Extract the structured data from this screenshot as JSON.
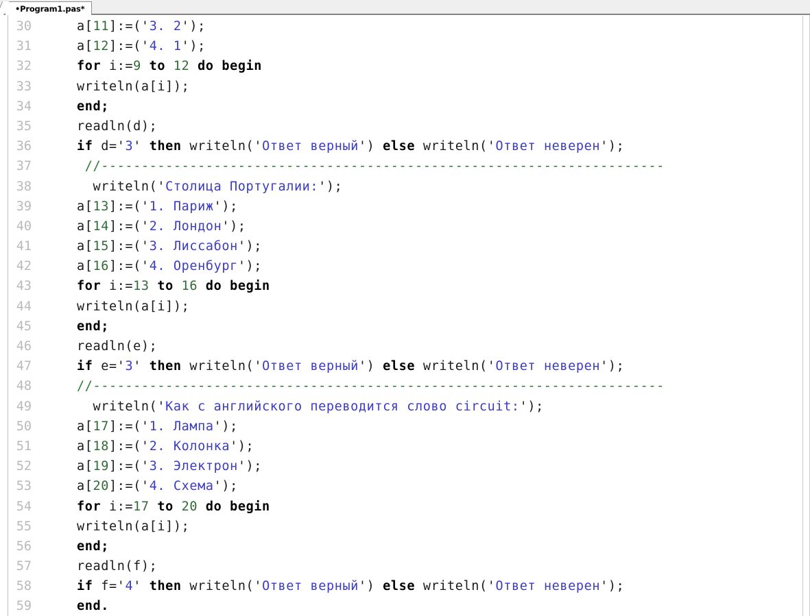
{
  "window": {
    "title": "Program1.pas",
    "background": "#ffffff"
  },
  "tabbar": {
    "tabs": [
      {
        "label": "•Program1.pas*",
        "active": true,
        "modified": true
      }
    ]
  },
  "colors": {
    "keyword": "#000000",
    "number": "#2f6b35",
    "string": "#3b3bc4",
    "comment": "#2b7a35",
    "identifier": "#1a1a1a",
    "line_number": "#b9b9b9",
    "editor_background": "#ffffff",
    "tabbar_background": "#efefef"
  },
  "editor": {
    "language": "pascal",
    "first_visible_line": 30,
    "last_visible_line": 59,
    "lines": [
      {
        "n": "30",
        "tokens": [
          {
            "t": "a",
            "c": "tok-id"
          },
          {
            "t": "[",
            "c": "tok-punc"
          },
          {
            "t": "11",
            "c": "tok-num"
          },
          {
            "t": "]:=('",
            "c": "tok-punc"
          },
          {
            "t": "3. 2",
            "c": "tok-str"
          },
          {
            "t": "');",
            "c": "tok-punc"
          }
        ]
      },
      {
        "n": "31",
        "tokens": [
          {
            "t": "a",
            "c": "tok-id"
          },
          {
            "t": "[",
            "c": "tok-punc"
          },
          {
            "t": "12",
            "c": "tok-num"
          },
          {
            "t": "]:=('",
            "c": "tok-punc"
          },
          {
            "t": "4. 1",
            "c": "tok-str"
          },
          {
            "t": "');",
            "c": "tok-punc"
          }
        ]
      },
      {
        "n": "32",
        "tokens": [
          {
            "t": "for",
            "c": "tok-kw"
          },
          {
            "t": " i:=",
            "c": "tok-id"
          },
          {
            "t": "9",
            "c": "tok-num"
          },
          {
            "t": " ",
            "c": "tok-id"
          },
          {
            "t": "to",
            "c": "tok-kw"
          },
          {
            "t": " ",
            "c": "tok-id"
          },
          {
            "t": "12",
            "c": "tok-num"
          },
          {
            "t": " ",
            "c": "tok-id"
          },
          {
            "t": "do begin",
            "c": "tok-kw"
          }
        ]
      },
      {
        "n": "33",
        "tokens": [
          {
            "t": "writeln(a[i]);",
            "c": "tok-id"
          }
        ]
      },
      {
        "n": "34",
        "tokens": [
          {
            "t": "end;",
            "c": "tok-kw"
          }
        ]
      },
      {
        "n": "35",
        "tokens": [
          {
            "t": "readln(d);",
            "c": "tok-id"
          }
        ]
      },
      {
        "n": "36",
        "tokens": [
          {
            "t": "if",
            "c": "tok-kw"
          },
          {
            "t": " d=",
            "c": "tok-id"
          },
          {
            "t": "'",
            "c": "tok-punc"
          },
          {
            "t": "3",
            "c": "tok-str"
          },
          {
            "t": "'",
            "c": "tok-punc"
          },
          {
            "t": " ",
            "c": "tok-id"
          },
          {
            "t": "then",
            "c": "tok-kw"
          },
          {
            "t": " writeln(",
            "c": "tok-id"
          },
          {
            "t": "'",
            "c": "tok-punc"
          },
          {
            "t": "Ответ верный",
            "c": "tok-str"
          },
          {
            "t": "'",
            "c": "tok-punc"
          },
          {
            "t": ") ",
            "c": "tok-id"
          },
          {
            "t": "else",
            "c": "tok-kw"
          },
          {
            "t": " writeln(",
            "c": "tok-id"
          },
          {
            "t": "'",
            "c": "tok-punc"
          },
          {
            "t": "Ответ неверен",
            "c": "tok-str"
          },
          {
            "t": "'",
            "c": "tok-punc"
          },
          {
            "t": ");",
            "c": "tok-id"
          }
        ]
      },
      {
        "n": "37",
        "tokens": [
          {
            "t": " //----------------------------------------------------------------------",
            "c": "tok-com"
          }
        ]
      },
      {
        "n": "38",
        "tokens": [
          {
            "t": "  writeln(",
            "c": "tok-id"
          },
          {
            "t": "'",
            "c": "tok-punc"
          },
          {
            "t": "Столица Португалии:",
            "c": "tok-str"
          },
          {
            "t": "'",
            "c": "tok-punc"
          },
          {
            "t": ");",
            "c": "tok-id"
          }
        ]
      },
      {
        "n": "39",
        "tokens": [
          {
            "t": "a",
            "c": "tok-id"
          },
          {
            "t": "[",
            "c": "tok-punc"
          },
          {
            "t": "13",
            "c": "tok-num"
          },
          {
            "t": "]:=('",
            "c": "tok-punc"
          },
          {
            "t": "1. Париж",
            "c": "tok-str"
          },
          {
            "t": "');",
            "c": "tok-punc"
          }
        ]
      },
      {
        "n": "40",
        "tokens": [
          {
            "t": "a",
            "c": "tok-id"
          },
          {
            "t": "[",
            "c": "tok-punc"
          },
          {
            "t": "14",
            "c": "tok-num"
          },
          {
            "t": "]:=('",
            "c": "tok-punc"
          },
          {
            "t": "2. Лондон",
            "c": "tok-str"
          },
          {
            "t": "');",
            "c": "tok-punc"
          }
        ]
      },
      {
        "n": "41",
        "tokens": [
          {
            "t": "a",
            "c": "tok-id"
          },
          {
            "t": "[",
            "c": "tok-punc"
          },
          {
            "t": "15",
            "c": "tok-num"
          },
          {
            "t": "]:=('",
            "c": "tok-punc"
          },
          {
            "t": "3. Лиссабон",
            "c": "tok-str"
          },
          {
            "t": "');",
            "c": "tok-punc"
          }
        ]
      },
      {
        "n": "42",
        "tokens": [
          {
            "t": "a",
            "c": "tok-id"
          },
          {
            "t": "[",
            "c": "tok-punc"
          },
          {
            "t": "16",
            "c": "tok-num"
          },
          {
            "t": "]:=('",
            "c": "tok-punc"
          },
          {
            "t": "4. Оренбург",
            "c": "tok-str"
          },
          {
            "t": "');",
            "c": "tok-punc"
          }
        ]
      },
      {
        "n": "43",
        "tokens": [
          {
            "t": "for",
            "c": "tok-kw"
          },
          {
            "t": " i:=",
            "c": "tok-id"
          },
          {
            "t": "13",
            "c": "tok-num"
          },
          {
            "t": " ",
            "c": "tok-id"
          },
          {
            "t": "to",
            "c": "tok-kw"
          },
          {
            "t": " ",
            "c": "tok-id"
          },
          {
            "t": "16",
            "c": "tok-num"
          },
          {
            "t": " ",
            "c": "tok-id"
          },
          {
            "t": "do begin",
            "c": "tok-kw"
          }
        ]
      },
      {
        "n": "44",
        "tokens": [
          {
            "t": "writeln(a[i]);",
            "c": "tok-id"
          }
        ]
      },
      {
        "n": "45",
        "tokens": [
          {
            "t": "end;",
            "c": "tok-kw"
          }
        ]
      },
      {
        "n": "46",
        "tokens": [
          {
            "t": "readln(e);",
            "c": "tok-id"
          }
        ]
      },
      {
        "n": "47",
        "tokens": [
          {
            "t": "if",
            "c": "tok-kw"
          },
          {
            "t": " e=",
            "c": "tok-id"
          },
          {
            "t": "'",
            "c": "tok-punc"
          },
          {
            "t": "3",
            "c": "tok-str"
          },
          {
            "t": "'",
            "c": "tok-punc"
          },
          {
            "t": " ",
            "c": "tok-id"
          },
          {
            "t": "then",
            "c": "tok-kw"
          },
          {
            "t": " writeln(",
            "c": "tok-id"
          },
          {
            "t": "'",
            "c": "tok-punc"
          },
          {
            "t": "Ответ верный",
            "c": "tok-str"
          },
          {
            "t": "'",
            "c": "tok-punc"
          },
          {
            "t": ") ",
            "c": "tok-id"
          },
          {
            "t": "else",
            "c": "tok-kw"
          },
          {
            "t": " writeln(",
            "c": "tok-id"
          },
          {
            "t": "'",
            "c": "tok-punc"
          },
          {
            "t": "Ответ неверен",
            "c": "tok-str"
          },
          {
            "t": "'",
            "c": "tok-punc"
          },
          {
            "t": ");",
            "c": "tok-id"
          }
        ]
      },
      {
        "n": "48",
        "tokens": [
          {
            "t": "//-----------------------------------------------------------------------",
            "c": "tok-com"
          }
        ]
      },
      {
        "n": "49",
        "tokens": [
          {
            "t": "  writeln(",
            "c": "tok-id"
          },
          {
            "t": "'",
            "c": "tok-punc"
          },
          {
            "t": "Как с английского переводится слово circuit:",
            "c": "tok-str"
          },
          {
            "t": "'",
            "c": "tok-punc"
          },
          {
            "t": ");",
            "c": "tok-id"
          }
        ]
      },
      {
        "n": "50",
        "tokens": [
          {
            "t": "a",
            "c": "tok-id"
          },
          {
            "t": "[",
            "c": "tok-punc"
          },
          {
            "t": "17",
            "c": "tok-num"
          },
          {
            "t": "]:=('",
            "c": "tok-punc"
          },
          {
            "t": "1. Лампа",
            "c": "tok-str"
          },
          {
            "t": "');",
            "c": "tok-punc"
          }
        ]
      },
      {
        "n": "51",
        "tokens": [
          {
            "t": "a",
            "c": "tok-id"
          },
          {
            "t": "[",
            "c": "tok-punc"
          },
          {
            "t": "18",
            "c": "tok-num"
          },
          {
            "t": "]:=('",
            "c": "tok-punc"
          },
          {
            "t": "2. Колонка",
            "c": "tok-str"
          },
          {
            "t": "');",
            "c": "tok-punc"
          }
        ]
      },
      {
        "n": "52",
        "tokens": [
          {
            "t": "a",
            "c": "tok-id"
          },
          {
            "t": "[",
            "c": "tok-punc"
          },
          {
            "t": "19",
            "c": "tok-num"
          },
          {
            "t": "]:=('",
            "c": "tok-punc"
          },
          {
            "t": "3. Электрон",
            "c": "tok-str"
          },
          {
            "t": "');",
            "c": "tok-punc"
          }
        ]
      },
      {
        "n": "53",
        "tokens": [
          {
            "t": "a",
            "c": "tok-id"
          },
          {
            "t": "[",
            "c": "tok-punc"
          },
          {
            "t": "20",
            "c": "tok-num"
          },
          {
            "t": "]:=('",
            "c": "tok-punc"
          },
          {
            "t": "4. Схема",
            "c": "tok-str"
          },
          {
            "t": "');",
            "c": "tok-punc"
          }
        ]
      },
      {
        "n": "54",
        "tokens": [
          {
            "t": "for",
            "c": "tok-kw"
          },
          {
            "t": " i:=",
            "c": "tok-id"
          },
          {
            "t": "17",
            "c": "tok-num"
          },
          {
            "t": " ",
            "c": "tok-id"
          },
          {
            "t": "to",
            "c": "tok-kw"
          },
          {
            "t": " ",
            "c": "tok-id"
          },
          {
            "t": "20",
            "c": "tok-num"
          },
          {
            "t": " ",
            "c": "tok-id"
          },
          {
            "t": "do begin",
            "c": "tok-kw"
          }
        ]
      },
      {
        "n": "55",
        "tokens": [
          {
            "t": "writeln(a[i]);",
            "c": "tok-id"
          }
        ]
      },
      {
        "n": "56",
        "tokens": [
          {
            "t": "end;",
            "c": "tok-kw"
          }
        ]
      },
      {
        "n": "57",
        "tokens": [
          {
            "t": "readln(f);",
            "c": "tok-id"
          }
        ]
      },
      {
        "n": "58",
        "tokens": [
          {
            "t": "if",
            "c": "tok-kw"
          },
          {
            "t": " f=",
            "c": "tok-id"
          },
          {
            "t": "'",
            "c": "tok-punc"
          },
          {
            "t": "4",
            "c": "tok-str"
          },
          {
            "t": "'",
            "c": "tok-punc"
          },
          {
            "t": " ",
            "c": "tok-id"
          },
          {
            "t": "then",
            "c": "tok-kw"
          },
          {
            "t": " writeln(",
            "c": "tok-id"
          },
          {
            "t": "'",
            "c": "tok-punc"
          },
          {
            "t": "Ответ верный",
            "c": "tok-str"
          },
          {
            "t": "'",
            "c": "tok-punc"
          },
          {
            "t": ") ",
            "c": "tok-id"
          },
          {
            "t": "else",
            "c": "tok-kw"
          },
          {
            "t": " writeln(",
            "c": "tok-id"
          },
          {
            "t": "'",
            "c": "tok-punc"
          },
          {
            "t": "Ответ неверен",
            "c": "tok-str"
          },
          {
            "t": "'",
            "c": "tok-punc"
          },
          {
            "t": ");",
            "c": "tok-id"
          }
        ]
      },
      {
        "n": "59",
        "tokens": [
          {
            "t": "end.",
            "c": "tok-kw"
          }
        ]
      }
    ]
  }
}
